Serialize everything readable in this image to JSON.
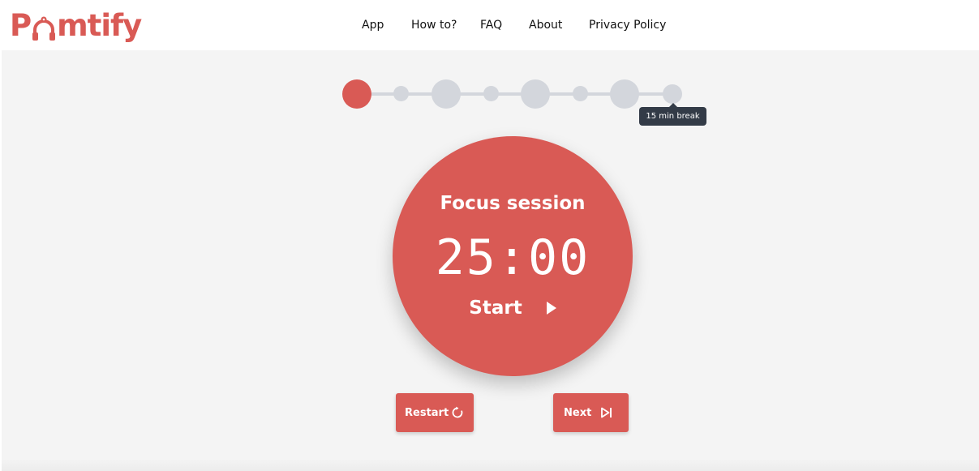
{
  "brand": {
    "logo_prefix": "P",
    "logo_suffix": "mtify",
    "logo_icon": "headphones-tomato-icon",
    "accent_color": "#d95a55"
  },
  "nav": {
    "items": [
      {
        "label": "App"
      },
      {
        "label": "How to?"
      },
      {
        "label": "FAQ"
      },
      {
        "label": "About"
      },
      {
        "label": "Privacy Policy"
      }
    ]
  },
  "progress": {
    "steps": [
      "focus",
      "short-break",
      "focus",
      "short-break",
      "focus",
      "short-break",
      "focus",
      "long-break"
    ],
    "active_index": 0,
    "tooltip": "15 min break",
    "inactive_color": "#d3d6dc"
  },
  "timer": {
    "session_label": "Focus session",
    "time": "25:00",
    "start_label": "Start",
    "start_icon": "play-icon"
  },
  "controls": {
    "restart_label": "Restart",
    "restart_icon": "restart-icon",
    "next_label": "Next",
    "next_icon": "skip-next-icon"
  }
}
